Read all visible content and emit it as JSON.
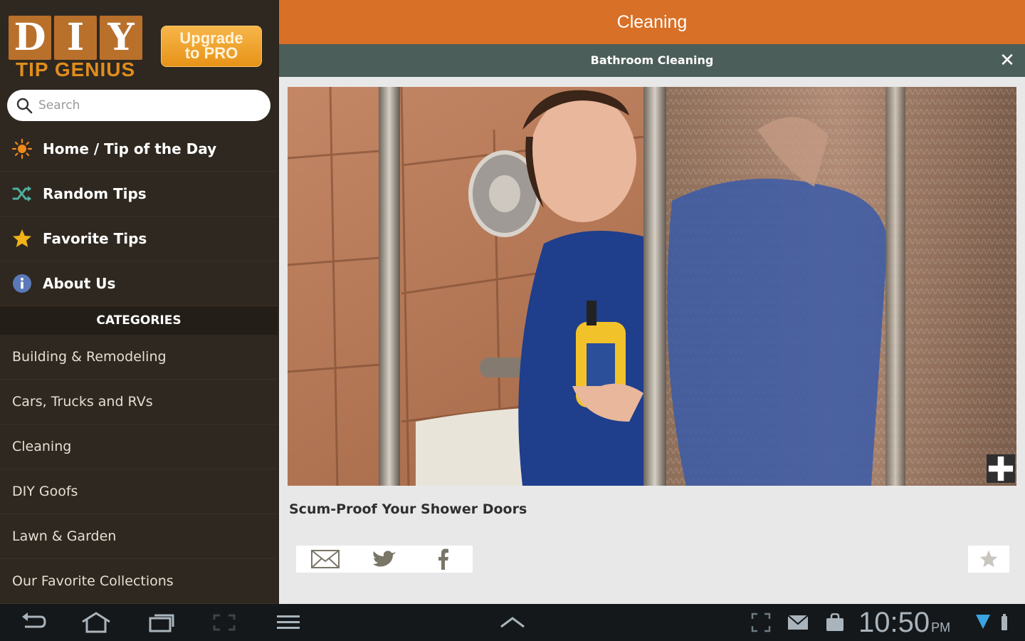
{
  "brand": {
    "letters": [
      "D",
      "I",
      "Y"
    ],
    "subtitle": "TIP GENIUS",
    "upgrade_label": "Upgrade\nto PRO"
  },
  "search": {
    "placeholder": "Search"
  },
  "nav": [
    {
      "label": "Home / Tip of the Day",
      "icon": "sun-icon"
    },
    {
      "label": "Random Tips",
      "icon": "shuffle-icon"
    },
    {
      "label": "Favorite Tips",
      "icon": "star-icon"
    },
    {
      "label": "About Us",
      "icon": "info-icon"
    }
  ],
  "categories": {
    "header": "CATEGORIES",
    "items": [
      "Building & Remodeling",
      "Cars, Trucks and RVs",
      "Cleaning",
      "DIY Goofs",
      "Lawn & Garden",
      "Our Favorite Collections"
    ]
  },
  "main": {
    "title": "Cleaning",
    "subtitle": "Bathroom Cleaning",
    "close_glyph": "✕",
    "tip_title": "Scum-Proof Your Shower Doors"
  },
  "status": {
    "time": "10:50",
    "ampm": "PM"
  },
  "colors": {
    "accent_orange": "#d87027",
    "subtitle_teal": "#4c5e59",
    "sidebar_bg": "#2f2820",
    "upgrade_gold": "#e79318"
  }
}
